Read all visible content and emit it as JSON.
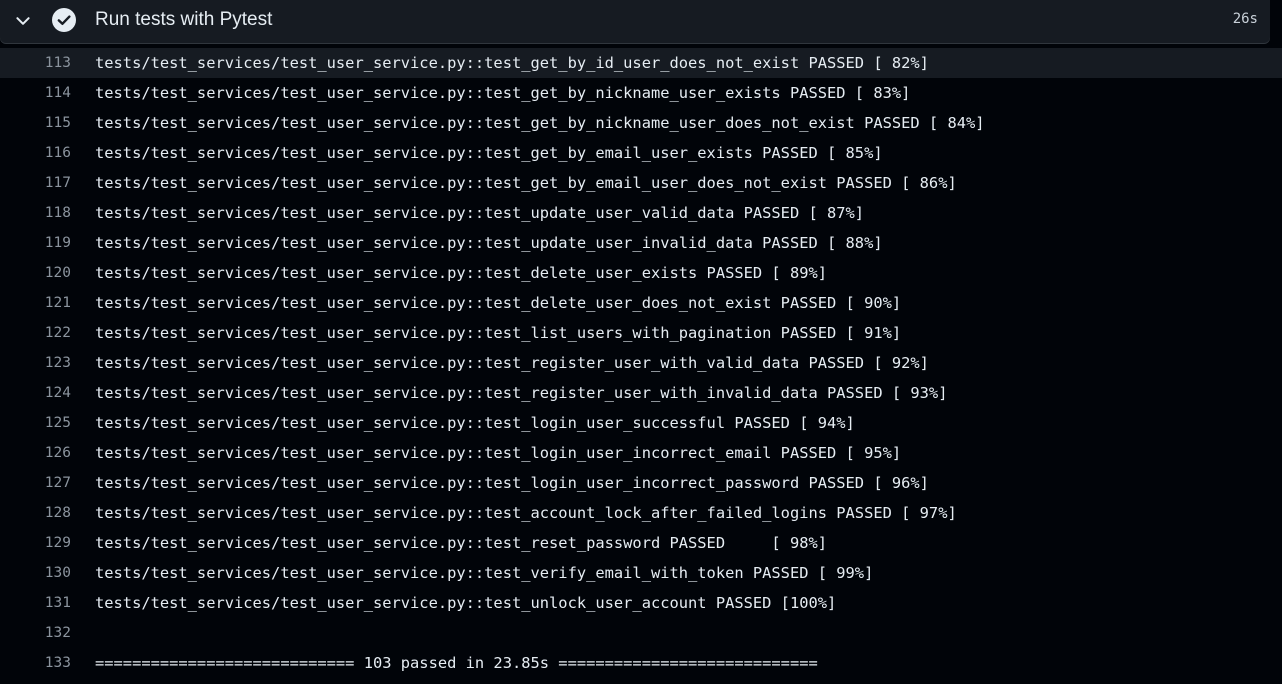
{
  "step": {
    "title": "Run tests with Pytest",
    "duration": "26s",
    "status_icon": "check-circle-icon",
    "toggle_icon": "chevron-down-icon"
  },
  "log": {
    "lines": [
      {
        "num": "113",
        "text": "tests/test_services/test_user_service.py::test_get_by_id_user_does_not_exist PASSED [ 82%]"
      },
      {
        "num": "114",
        "text": "tests/test_services/test_user_service.py::test_get_by_nickname_user_exists PASSED [ 83%]"
      },
      {
        "num": "115",
        "text": "tests/test_services/test_user_service.py::test_get_by_nickname_user_does_not_exist PASSED [ 84%]"
      },
      {
        "num": "116",
        "text": "tests/test_services/test_user_service.py::test_get_by_email_user_exists PASSED [ 85%]"
      },
      {
        "num": "117",
        "text": "tests/test_services/test_user_service.py::test_get_by_email_user_does_not_exist PASSED [ 86%]"
      },
      {
        "num": "118",
        "text": "tests/test_services/test_user_service.py::test_update_user_valid_data PASSED [ 87%]"
      },
      {
        "num": "119",
        "text": "tests/test_services/test_user_service.py::test_update_user_invalid_data PASSED [ 88%]"
      },
      {
        "num": "120",
        "text": "tests/test_services/test_user_service.py::test_delete_user_exists PASSED [ 89%]"
      },
      {
        "num": "121",
        "text": "tests/test_services/test_user_service.py::test_delete_user_does_not_exist PASSED [ 90%]"
      },
      {
        "num": "122",
        "text": "tests/test_services/test_user_service.py::test_list_users_with_pagination PASSED [ 91%]"
      },
      {
        "num": "123",
        "text": "tests/test_services/test_user_service.py::test_register_user_with_valid_data PASSED [ 92%]"
      },
      {
        "num": "124",
        "text": "tests/test_services/test_user_service.py::test_register_user_with_invalid_data PASSED [ 93%]"
      },
      {
        "num": "125",
        "text": "tests/test_services/test_user_service.py::test_login_user_successful PASSED [ 94%]"
      },
      {
        "num": "126",
        "text": "tests/test_services/test_user_service.py::test_login_user_incorrect_email PASSED [ 95%]"
      },
      {
        "num": "127",
        "text": "tests/test_services/test_user_service.py::test_login_user_incorrect_password PASSED [ 96%]"
      },
      {
        "num": "128",
        "text": "tests/test_services/test_user_service.py::test_account_lock_after_failed_logins PASSED [ 97%]"
      },
      {
        "num": "129",
        "text": "tests/test_services/test_user_service.py::test_reset_password PASSED     [ 98%]"
      },
      {
        "num": "130",
        "text": "tests/test_services/test_user_service.py::test_verify_email_with_token PASSED [ 99%]"
      },
      {
        "num": "131",
        "text": "tests/test_services/test_user_service.py::test_unlock_user_account PASSED [100%]"
      },
      {
        "num": "132",
        "text": ""
      },
      {
        "num": "133",
        "text": "============================ 103 passed in 23.85s ============================"
      }
    ]
  }
}
